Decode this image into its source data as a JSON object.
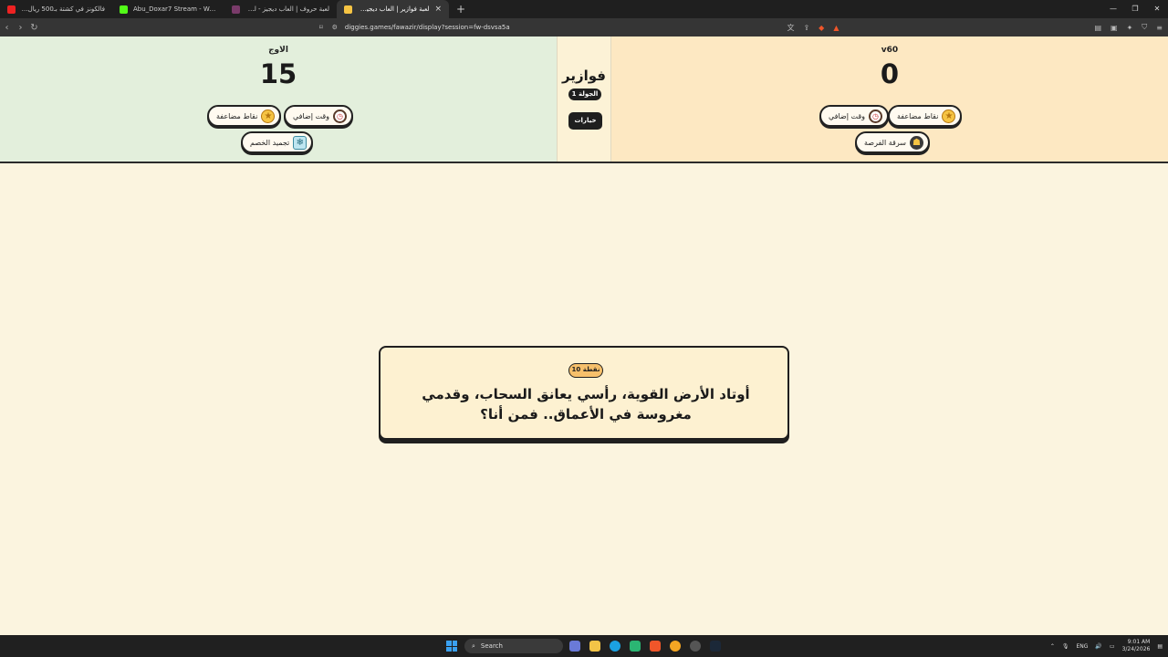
{
  "browser": {
    "tabs": [
      {
        "title": "فالكونز في كشتة بـ500 ريال وكشتة بـ100",
        "favicon_color": "#e22"
      },
      {
        "title": "Abu_Doxar7 Stream - Watch Live on",
        "favicon_color": "#53fc18"
      },
      {
        "title": "لعبة حروف | العاب ديجيز - لعبة تفاعلية",
        "favicon_color": "#7a3b6a"
      },
      {
        "title": "لعبة فوازير | العاب ديجيز - لعبة لنا",
        "favicon_color": "#f6c443"
      }
    ],
    "close_tab": "×",
    "new_tab": "+",
    "url": "diggies.games/fawazir/display?session=fw-dsvsa5a",
    "win_controls": [
      "—",
      "❐",
      "✕"
    ]
  },
  "left_team": {
    "name": "الاوج",
    "score": "15",
    "powerups": {
      "double_points": "نقاط مضاعفة",
      "extra_time": "وقت إضافي",
      "freeze_opponent": "تجميد الخصم"
    }
  },
  "right_team": {
    "name": "v60",
    "score": "0",
    "powerups": {
      "double_points": "نقاط مضاعفة",
      "extra_time": "وقت إضافي",
      "steal_chance": "سرقة الفرصة"
    }
  },
  "center": {
    "game_title": "فوازير",
    "round": "الجولة 1",
    "options": "خيارات"
  },
  "question": {
    "points": "10 نقطة",
    "text": "أوتاد الأرض القوية، رأسي يعانق السحاب، وقدمي مغروسة في الأعماق.. فمن أنا؟"
  },
  "taskbar": {
    "search": "Search",
    "language": "ENG",
    "time": "9:01 AM",
    "date": "3/24/2026"
  },
  "colors": {
    "left_bg": "#e3efdc",
    "right_bg": "#fde8c2",
    "page_bg": "#fbf4df",
    "card_bg": "#fdf1d1",
    "badge_bg": "#f6c06b"
  }
}
